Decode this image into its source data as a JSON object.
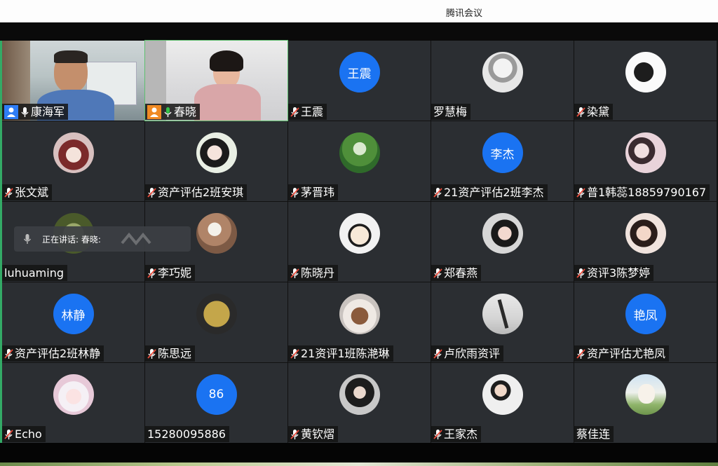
{
  "window": {
    "title": "腾讯会议"
  },
  "speaking": {
    "label": "正在讲话: 春晓:"
  },
  "participants": [
    {
      "name": "康海军"
    },
    {
      "name": "春晓"
    },
    {
      "name": "王震",
      "initials": "王震"
    },
    {
      "name": "罗慧梅"
    },
    {
      "name": "染黛"
    },
    {
      "name": "张文斌"
    },
    {
      "name": "资产评估2班安琪"
    },
    {
      "name": "茅晋玮"
    },
    {
      "name": "21资产评估2班李杰",
      "initials": "李杰"
    },
    {
      "name": "普1韩蕊18859790167"
    },
    {
      "name": "luhuaming"
    },
    {
      "name": "李巧妮"
    },
    {
      "name": "陈晓丹"
    },
    {
      "name": "郑春燕"
    },
    {
      "name": "资评3陈梦婷"
    },
    {
      "name": "资产评估2班林静",
      "initials": "林静"
    },
    {
      "name": "陈思远"
    },
    {
      "name": "21资评1班陈滟琳"
    },
    {
      "name": "卢欣雨资评"
    },
    {
      "name": "资产评估尤艳凤",
      "initials": "艳凤"
    },
    {
      "name": "Echo"
    },
    {
      "name": "15280095886",
      "initials": "86"
    },
    {
      "name": "黄钦熠"
    },
    {
      "name": "王家杰"
    },
    {
      "name": "蔡佳连"
    }
  ],
  "colors": {
    "accent_blue": "#1a73f2",
    "tile_bg": "#2b2e32",
    "host_badge": "#2f7df6",
    "cohost_badge": "#f08a24",
    "mic_on": "#35c24a",
    "mic_off": "#e74c3c"
  }
}
